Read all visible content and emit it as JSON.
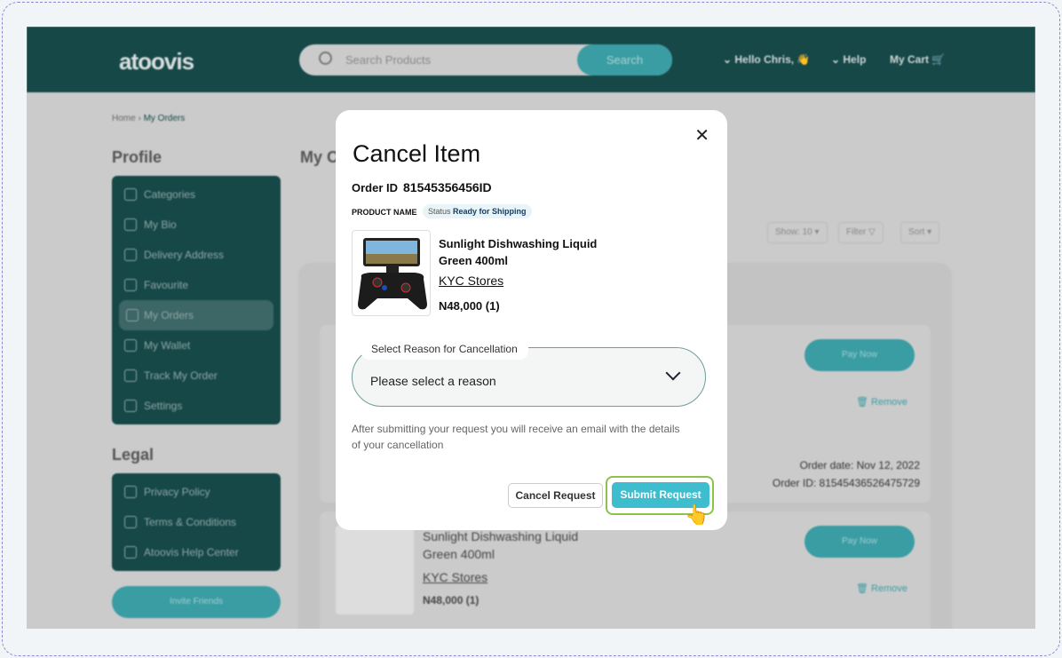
{
  "header": {
    "logo": "atoovis",
    "search_placeholder": "Search Products",
    "search_button": "Search",
    "greeting": "Hello Chris,",
    "help": "Help",
    "cart": "My Cart"
  },
  "breadcrumb": {
    "home": "Home",
    "current": "My Orders"
  },
  "sidebar": {
    "profile_title": "Profile",
    "profile_items": [
      "Categories",
      "My Bio",
      "Delivery Address",
      "Favourite",
      "My Orders",
      "My Wallet",
      "Track My Order",
      "Settings"
    ],
    "legal_title": "Legal",
    "legal_items": [
      "Privacy Policy",
      "Terms & Conditions",
      "Atoovis Help Center"
    ],
    "invite": "Invite Friends"
  },
  "main": {
    "title": "My Orders",
    "show": "Show: 10",
    "filter": "Filter",
    "sort": "Sort",
    "pay_now": "Pay Now",
    "remove": "Remove",
    "order_date": "Order date: Nov 12, 2022",
    "order_id": "Order ID: 81545436526475729",
    "product_name": "Sunlight Dishwashing Liquid",
    "product_variant": "Green 400ml",
    "store": "KYC Stores",
    "price": "N48,000 (1)"
  },
  "modal": {
    "title": "Cancel Item",
    "order_id_label": "Order ID",
    "order_id": "81545356456ID",
    "product_name_label": "PRODUCT NAME",
    "status_label": "Status",
    "status": "Ready for Shipping",
    "product_line1": "Sunlight Dishwashing Liquid",
    "product_line2": "Green 400ml",
    "store": "KYC Stores",
    "price": "N48,000 (1)",
    "select_label": "Select Reason for Cancellation",
    "select_value": "Please select a reason",
    "note": "After submitting your request you will receive an email with the details of your cancellation",
    "cancel_button": "Cancel Request",
    "submit_button": "Submit Request"
  },
  "colors": {
    "brand": "#164848",
    "accent": "#3dbdce",
    "focus": "#8cc24a"
  }
}
